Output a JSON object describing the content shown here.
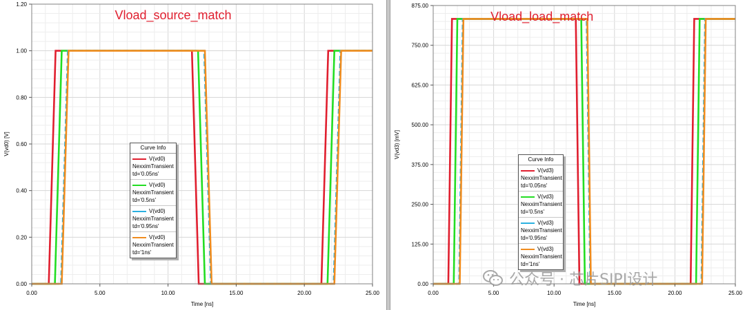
{
  "chart_data": [
    {
      "type": "line",
      "title": "Vload_source_match",
      "title_color": "#e01e2e",
      "xlabel": "Time [ns]",
      "ylabel": "V(vd0) [V]",
      "xlim": [
        0,
        25
      ],
      "ylim": [
        0,
        1.2
      ],
      "xticks": [
        "0.00",
        "5.00",
        "10.00",
        "15.00",
        "20.00",
        "25.00"
      ],
      "yticks": [
        "0.00",
        "0.20",
        "0.40",
        "0.60",
        "0.80",
        "1.00",
        "1.20"
      ],
      "grid": true,
      "legend_position": "center-left",
      "legend": {
        "title": "Curve Info",
        "entries": [
          {
            "name": "V(vd0)",
            "lines": [
              "NexximTransient",
              "td='0.05ns'"
            ],
            "color": "#e01e2e"
          },
          {
            "name": "V(vd0)",
            "lines": [
              "NexximTransient",
              "td='0.5ns'"
            ],
            "color": "#22dd22"
          },
          {
            "name": "V(vd0)",
            "lines": [
              "NexximTransient",
              "td='0.95ns'"
            ],
            "color": "#2ab0e0"
          },
          {
            "name": "V(vd0)",
            "lines": [
              "NexximTransient",
              "td='1ns'"
            ],
            "color": "#f08c1e"
          }
        ]
      },
      "series": [
        {
          "name": "V(vd0) NexximTransient td='0.05ns'",
          "color": "#e01e2e",
          "x": [
            0,
            1.25,
            1.75,
            11.75,
            12.25,
            21.25,
            21.75,
            25
          ],
          "y": [
            0,
            0,
            1,
            1,
            0,
            0,
            1,
            1
          ]
        },
        {
          "name": "V(vd0) NexximTransient td='0.5ns'",
          "color": "#22dd22",
          "x": [
            0,
            1.7,
            2.2,
            12.2,
            12.7,
            21.7,
            22.2,
            25
          ],
          "y": [
            0,
            0,
            1,
            1,
            0,
            0,
            1,
            1
          ]
        },
        {
          "name": "V(vd0) NexximTransient td='0.95ns'",
          "color": "#2ab0e0",
          "x": [
            0,
            2.15,
            2.65,
            12.65,
            13.15,
            22.15,
            22.65,
            25
          ],
          "y": [
            0,
            0,
            1,
            1,
            0,
            0,
            1,
            1
          ]
        },
        {
          "name": "V(vd0) NexximTransient td='1ns'",
          "color": "#f08c1e",
          "x": [
            0,
            2.2,
            2.7,
            12.7,
            13.2,
            22.2,
            22.7,
            25
          ],
          "y": [
            0,
            0,
            1,
            1,
            0,
            0,
            1,
            1
          ]
        }
      ]
    },
    {
      "type": "line",
      "title": "Vload_load_match",
      "title_color": "#e01e2e",
      "xlabel": "Time [ns]",
      "ylabel": "V(vd3) [mV]",
      "xlim": [
        0,
        25
      ],
      "ylim": [
        0,
        875
      ],
      "xticks": [
        "0.00",
        "5.00",
        "10.00",
        "15.00",
        "20.00",
        "25.00"
      ],
      "yticks": [
        "0.00",
        "125.00",
        "250.00",
        "375.00",
        "500.00",
        "625.00",
        "750.00",
        "875.00"
      ],
      "grid": true,
      "legend_position": "bottom-left",
      "legend": {
        "title": "Curve Info",
        "entries": [
          {
            "name": "V(vd3)",
            "lines": [
              "NexximTransient",
              "td='0.05ns'"
            ],
            "color": "#e01e2e"
          },
          {
            "name": "V(vd3)",
            "lines": [
              "NexximTransient",
              "td='0.5ns'"
            ],
            "color": "#22dd22"
          },
          {
            "name": "V(vd3)",
            "lines": [
              "NexximTransient",
              "td='0.95ns'"
            ],
            "color": "#2ab0e0"
          },
          {
            "name": "V(vd3)",
            "lines": [
              "NexximTransient",
              "td='1ns'"
            ],
            "color": "#f08c1e"
          }
        ]
      },
      "series": [
        {
          "name": "V(vd3) NexximTransient td='0.05ns'",
          "color": "#e01e2e",
          "x": [
            0,
            1.25,
            1.55,
            11.8,
            12.1,
            21.3,
            21.6,
            25
          ],
          "y": [
            0,
            0,
            833,
            833,
            0,
            0,
            833,
            833
          ]
        },
        {
          "name": "V(vd3) NexximTransient td='0.5ns'",
          "color": "#22dd22",
          "x": [
            0,
            1.7,
            2.0,
            12.25,
            12.55,
            21.75,
            22.05,
            25
          ],
          "y": [
            0,
            0,
            833,
            833,
            0,
            0,
            833,
            833
          ]
        },
        {
          "name": "V(vd3) NexximTransient td='0.95ns'",
          "color": "#2ab0e0",
          "x": [
            0,
            2.15,
            2.45,
            12.7,
            13.0,
            22.2,
            22.5,
            25
          ],
          "y": [
            0,
            0,
            833,
            833,
            0,
            0,
            833,
            833
          ]
        },
        {
          "name": "V(vd3) NexximTransient td='1ns'",
          "color": "#f08c1e",
          "x": [
            0,
            2.2,
            2.5,
            12.75,
            13.05,
            22.25,
            22.55,
            25
          ],
          "y": [
            0,
            0,
            833,
            833,
            0,
            0,
            833,
            833
          ]
        }
      ]
    }
  ],
  "watermark": {
    "text": "公众号 · 芯片SIPI设计",
    "icon": "wechat-icon"
  }
}
